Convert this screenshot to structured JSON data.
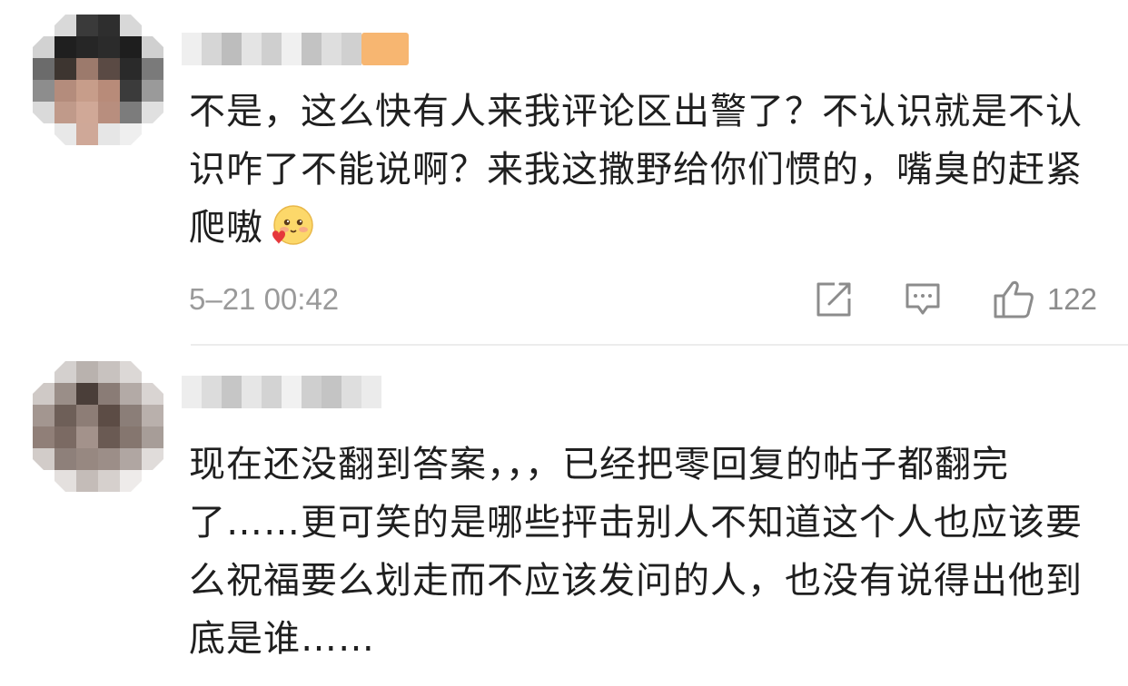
{
  "comments": [
    {
      "username": "",
      "text": "不是，这么快有人来我评论区出警了？不认识就是不认识咋了不能说啊？来我这撒野给你们惯的，嘴臭的赶紧爬嗷",
      "emoji": "shy-heart-emoji",
      "timestamp": "5–21 00:42",
      "like_count": "122",
      "has_vip_badge": true
    },
    {
      "username": "",
      "text": "现在还没翻到答案，，，已经把零回复的帖子都翻完了……更可笑的是哪些抨击别人不知道这个人也应该要么祝福要么划走而不应该发问的人，也没有说得出他到底是谁……"
    }
  ],
  "colors": {
    "text": "#1f1f1f",
    "meta": "#9a9a9a",
    "icon": "#8c8c8c",
    "vip_badge": "#f7b671",
    "divider": "#ececec"
  },
  "icons": [
    "share-icon",
    "reply-icon",
    "like-icon"
  ]
}
